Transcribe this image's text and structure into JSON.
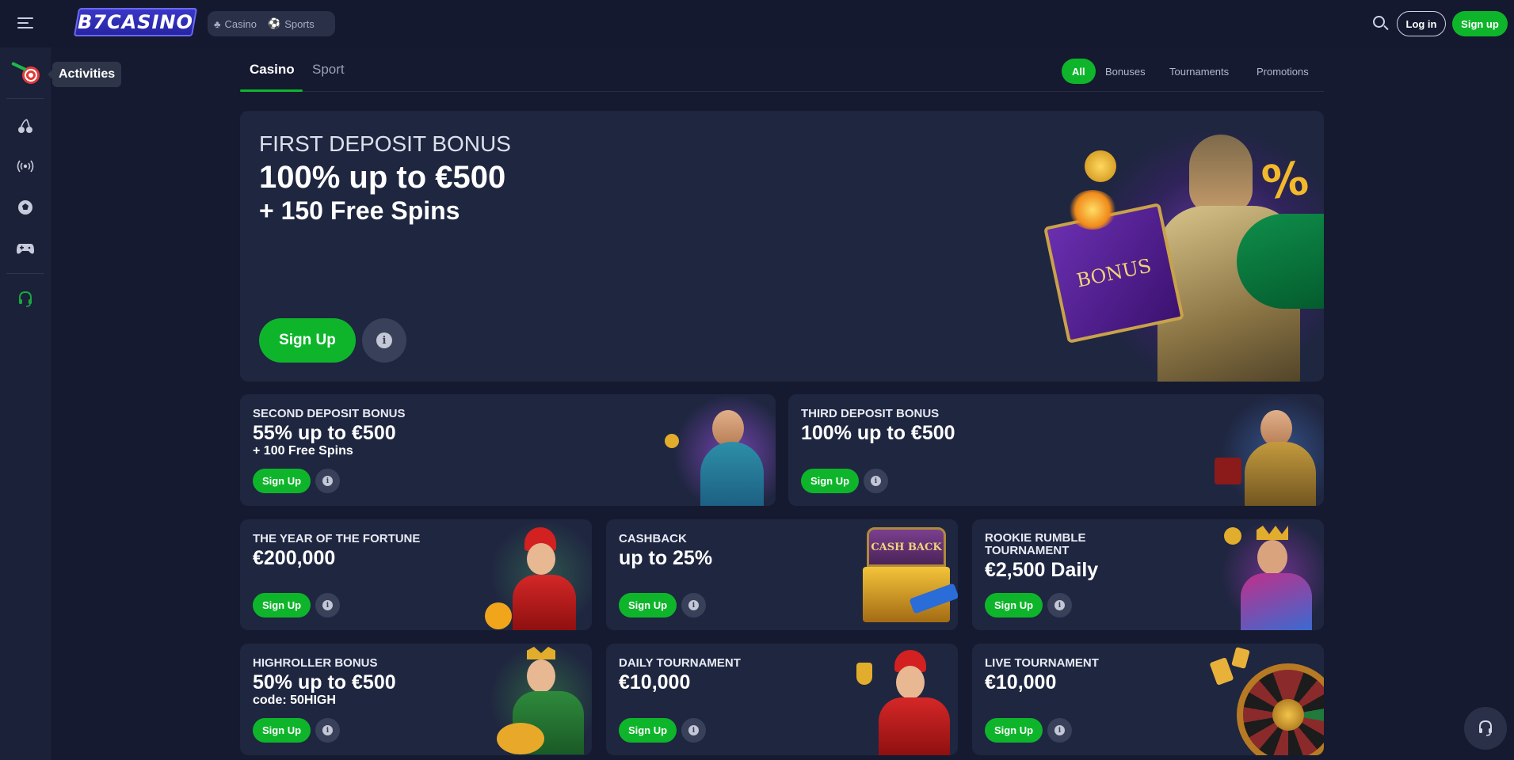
{
  "topbar": {
    "logo": "B7CASINO",
    "nav": [
      {
        "label": "Casino",
        "icon": "casino-icon"
      },
      {
        "label": "Sports",
        "icon": "soccer-ball-icon"
      }
    ],
    "login_label": "Log in",
    "signup_label": "Sign up"
  },
  "sidebar": {
    "tooltip": "Activities",
    "items": [
      "activities-icon",
      "casino-cherries-icon",
      "live-broadcast-icon",
      "sports-ball-icon",
      "gamepad-icon",
      "support-headset-icon"
    ]
  },
  "tabs": {
    "items": [
      "Casino",
      "Sport"
    ],
    "active": "Casino",
    "filters": [
      "All",
      "Bonuses",
      "Tournaments",
      "Promotions"
    ],
    "active_filter": "All"
  },
  "hero": {
    "title": "FIRST DEPOSIT BONUS",
    "amount": "100% up to €500",
    "extra": "+ 150 Free Spins",
    "book_text": "BONUS",
    "signup_label": "Sign Up"
  },
  "cards": [
    {
      "title": "SECOND DEPOSIT BONUS",
      "amount": "55% up to €500",
      "sub": "+ 100 Free Spins",
      "signup_label": "Sign Up"
    },
    {
      "title": "THIRD DEPOSIT BONUS",
      "amount": "100% up to €500",
      "sub": "",
      "signup_label": "Sign Up"
    },
    {
      "title": "THE YEAR OF THE FORTUNE",
      "amount": "€200,000",
      "sub": "",
      "signup_label": "Sign Up"
    },
    {
      "title": "CASHBACK",
      "amount": "up to 25%",
      "sub": "",
      "signup_label": "Sign Up",
      "art_text": "CASH BACK"
    },
    {
      "title": "ROOKIE RUMBLE TOURNAMENT",
      "amount": "€2,500 Daily",
      "sub": "",
      "signup_label": "Sign Up"
    },
    {
      "title": "HIGHROLLER BONUS",
      "amount": "50% up to €500",
      "sub": "code: 50HIGH",
      "signup_label": "Sign Up"
    },
    {
      "title": "DAILY TOURNAMENT",
      "amount": "€10,000",
      "sub": "",
      "signup_label": "Sign Up"
    },
    {
      "title": "LIVE TOURNAMENT",
      "amount": "€10,000",
      "sub": "",
      "signup_label": "Sign Up"
    }
  ],
  "colors": {
    "accent": "#0eb52b",
    "background": "#151a30",
    "card": "#1f2640",
    "logo": "#3b38c9"
  }
}
